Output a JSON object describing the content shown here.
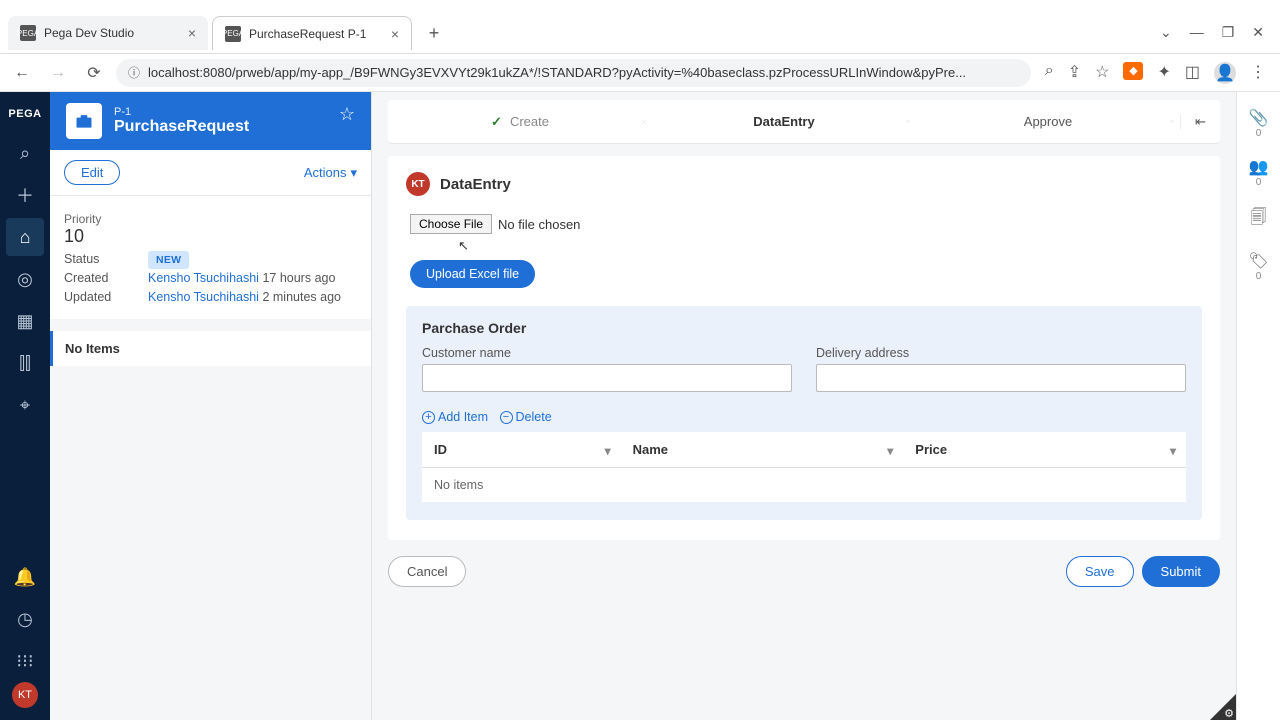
{
  "browser": {
    "tabs": [
      {
        "favicon": "PEGA",
        "title": "Pega Dev Studio"
      },
      {
        "favicon": "PEGA",
        "title": "PurchaseRequest P-1"
      }
    ],
    "url": "localhost:8080/prweb/app/my-app_/B9FWNGy3EVXVYt29k1ukZA*/!STANDARD?pyActivity=%40baseclass.pzProcessURLInWindow&pyPre..."
  },
  "rail": {
    "brand": "PEGA"
  },
  "caseHeader": {
    "id": "P-1",
    "name": "PurchaseRequest",
    "editLabel": "Edit",
    "actionsLabel": "Actions"
  },
  "summary": {
    "priorityLabel": "Priority",
    "priorityValue": "10",
    "statusLabel": "Status",
    "statusValue": "NEW",
    "createdLabel": "Created",
    "createdBy": "Kensho Tsuchihashi",
    "createdAgo": "17 hours ago",
    "updatedLabel": "Updated",
    "updatedBy": "Kensho Tsuchihashi",
    "updatedAgo": "2 minutes ago",
    "tabLabel": "No Items"
  },
  "stages": {
    "s1": "Create",
    "s2": "DataEntry",
    "s3": "Approve"
  },
  "assignment": {
    "avatar": "KT",
    "title": "DataEntry",
    "chooseFile": "Choose File",
    "noFile": "No file chosen",
    "uploadLabel": "Upload Excel file"
  },
  "po": {
    "heading": "Parchase Order",
    "custLabel": "Customer name",
    "custValue": "",
    "addrLabel": "Delivery address",
    "addrValue": "",
    "addItem": "Add Item",
    "delete": "Delete",
    "cols": {
      "id": "ID",
      "name": "Name",
      "price": "Price"
    },
    "empty": "No items"
  },
  "buttons": {
    "cancel": "Cancel",
    "save": "Save",
    "submit": "Submit"
  },
  "util": {
    "attachCount": "0",
    "followCount": "0",
    "tagCount": "0"
  }
}
